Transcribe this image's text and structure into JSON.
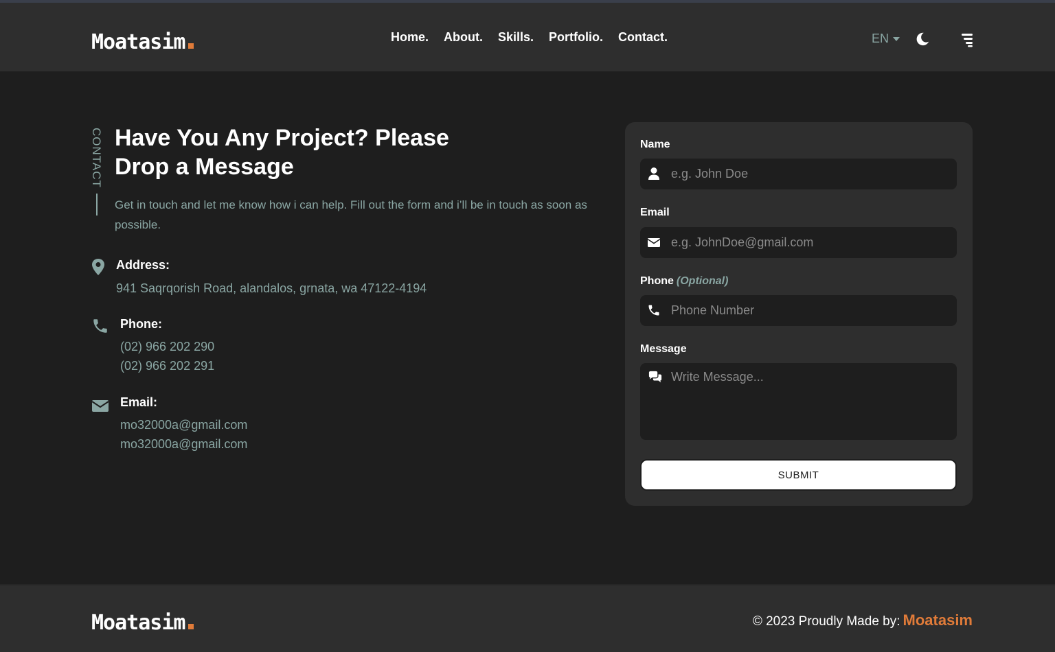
{
  "colors": {
    "accent": "#e07b39",
    "muted": "#8aa6a3",
    "background": "#1e1e1e",
    "surface": "#2e2e2e"
  },
  "header": {
    "logo": "Moatasim",
    "nav": [
      "Home.",
      "About.",
      "Skills.",
      "Portfolio.",
      "Contact."
    ],
    "language": "EN",
    "icons": [
      "moon-icon",
      "menu-icon"
    ]
  },
  "contact": {
    "side_label": "CONTACT",
    "title": "Have You Any Project? Please Drop a Message",
    "intro": "Get in touch and let me know how i can help. Fill out the form and i’ll be in touch as soon as possible.",
    "address": {
      "label": "Address:",
      "value": "941 Saqrqorish Road, alandalos, grnata, wa 47122-4194"
    },
    "phone": {
      "label": "Phone:",
      "values": [
        "(02) 966 202 290",
        "(02) 966 202 291"
      ]
    },
    "email": {
      "label": "Email:",
      "values": [
        "mo32000a@gmail.com",
        "mo32000a@gmail.com"
      ]
    }
  },
  "form": {
    "name": {
      "label": "Name",
      "placeholder": "e.g. John Doe"
    },
    "email": {
      "label": "Email",
      "placeholder": "e.g. JohnDoe@gmail.com"
    },
    "phone": {
      "label": "Phone",
      "optional": "(Optional)",
      "placeholder": "Phone Number"
    },
    "message": {
      "label": "Message",
      "placeholder": "Write Message..."
    },
    "submit": "SUBMIT"
  },
  "footer": {
    "logo": "Moatasim",
    "copyright": "© 2023 Proudly Made by:",
    "author": "Moatasim"
  }
}
